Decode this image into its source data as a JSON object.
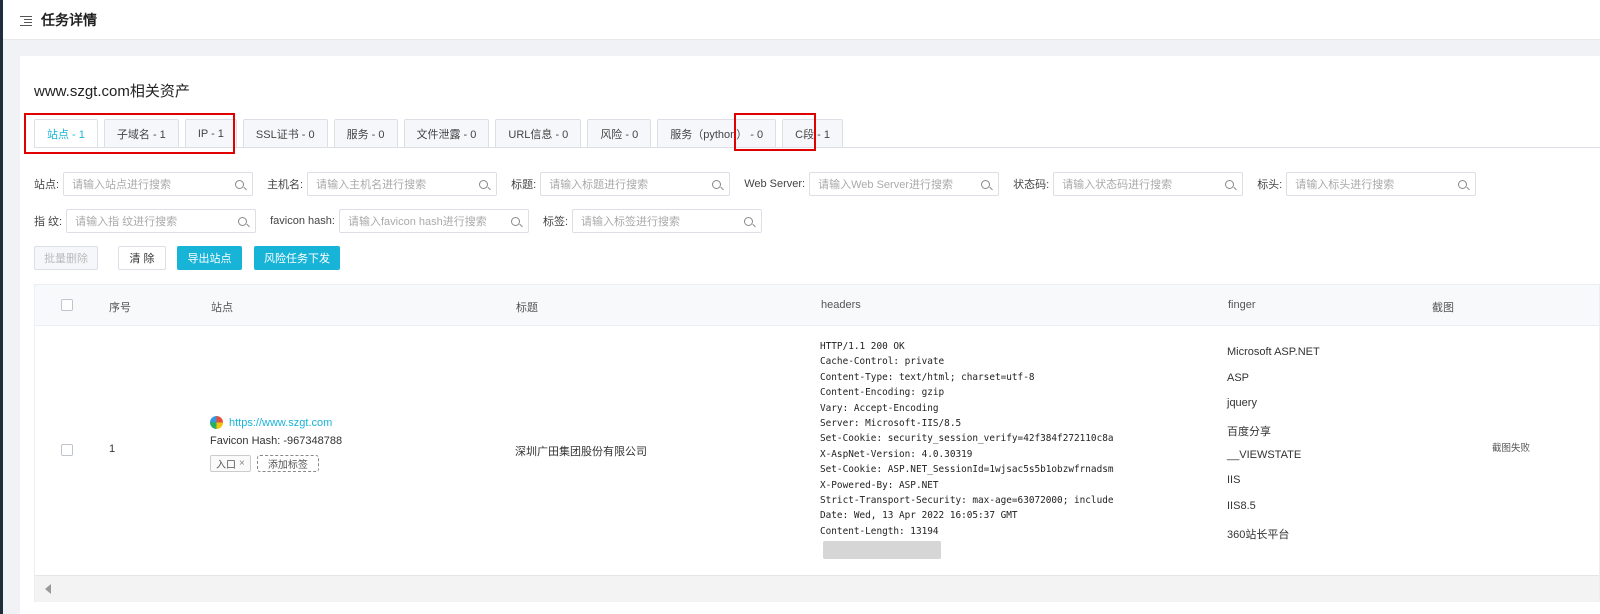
{
  "page_title": "任务详情",
  "section_title": "www.szgt.com相关资产",
  "tabs": [
    {
      "label": "站点 - 1"
    },
    {
      "label": "子域名 - 1"
    },
    {
      "label": "IP - 1"
    },
    {
      "label": "SSL证书 - 0"
    },
    {
      "label": "服务 - 0"
    },
    {
      "label": "文件泄露 - 0"
    },
    {
      "label": "URL信息 - 0"
    },
    {
      "label": "风险 - 0"
    },
    {
      "label": "服务（python） - 0"
    },
    {
      "label": "C段 - 1"
    }
  ],
  "filters": [
    {
      "label": "站点:",
      "placeholder": "请输入站点进行搜索"
    },
    {
      "label": "主机名:",
      "placeholder": "请输入主机名进行搜索"
    },
    {
      "label": "标题:",
      "placeholder": "请输入标题进行搜索"
    },
    {
      "label": "Web Server:",
      "placeholder": "请输入Web Server进行搜索"
    },
    {
      "label": "状态码:",
      "placeholder": "请输入状态码进行搜索"
    },
    {
      "label": "标头:",
      "placeholder": "请输入标头进行搜索"
    },
    {
      "label": "指 纹:",
      "placeholder": "请输入指 纹进行搜索"
    },
    {
      "label": "favicon hash:",
      "placeholder": "请输入favicon hash进行搜索"
    },
    {
      "label": "标签:",
      "placeholder": "请输入标签进行搜索"
    }
  ],
  "buttons": {
    "batch_delete": "批量删除",
    "clear": "清 除",
    "export": "导出站点",
    "risk_task": "风险任务下发"
  },
  "table": {
    "columns": [
      "序号",
      "站点",
      "标题",
      "headers",
      "finger",
      "截图"
    ],
    "row": {
      "index": "1",
      "site_url": "https://www.szgt.com",
      "favicon_hash": "Favicon Hash: -967348788",
      "tag": "入口",
      "add_tag": "添加标签",
      "title": "深圳广田集团股份有限公司",
      "headers": [
        "HTTP/1.1 200 OK",
        "Cache-Control: private",
        "Content-Type: text/html; charset=utf-8",
        "Content-Encoding: gzip",
        "Vary: Accept-Encoding",
        "Server: Microsoft-IIS/8.5",
        "Set-Cookie: security_session_verify=42f384f272110c8a",
        "X-AspNet-Version: 4.0.30319",
        "Set-Cookie: ASP.NET_SessionId=1wjsac5s5b1obzwfrnadsm",
        "X-Powered-By: ASP.NET",
        "Strict-Transport-Security: max-age=63072000; include",
        "Date: Wed, 13 Apr 2022 16:05:37 GMT",
        "Content-Length: 13194"
      ],
      "finger": [
        "Microsoft ASP.NET",
        "ASP",
        "jquery",
        "百度分享",
        "__VIEWSTATE",
        "IIS",
        "IIS8.5",
        "360站长平台"
      ],
      "screenshot": "截图失败"
    }
  },
  "colors": {
    "accent": "#18b4d8",
    "highlight_box": "#e10000"
  }
}
